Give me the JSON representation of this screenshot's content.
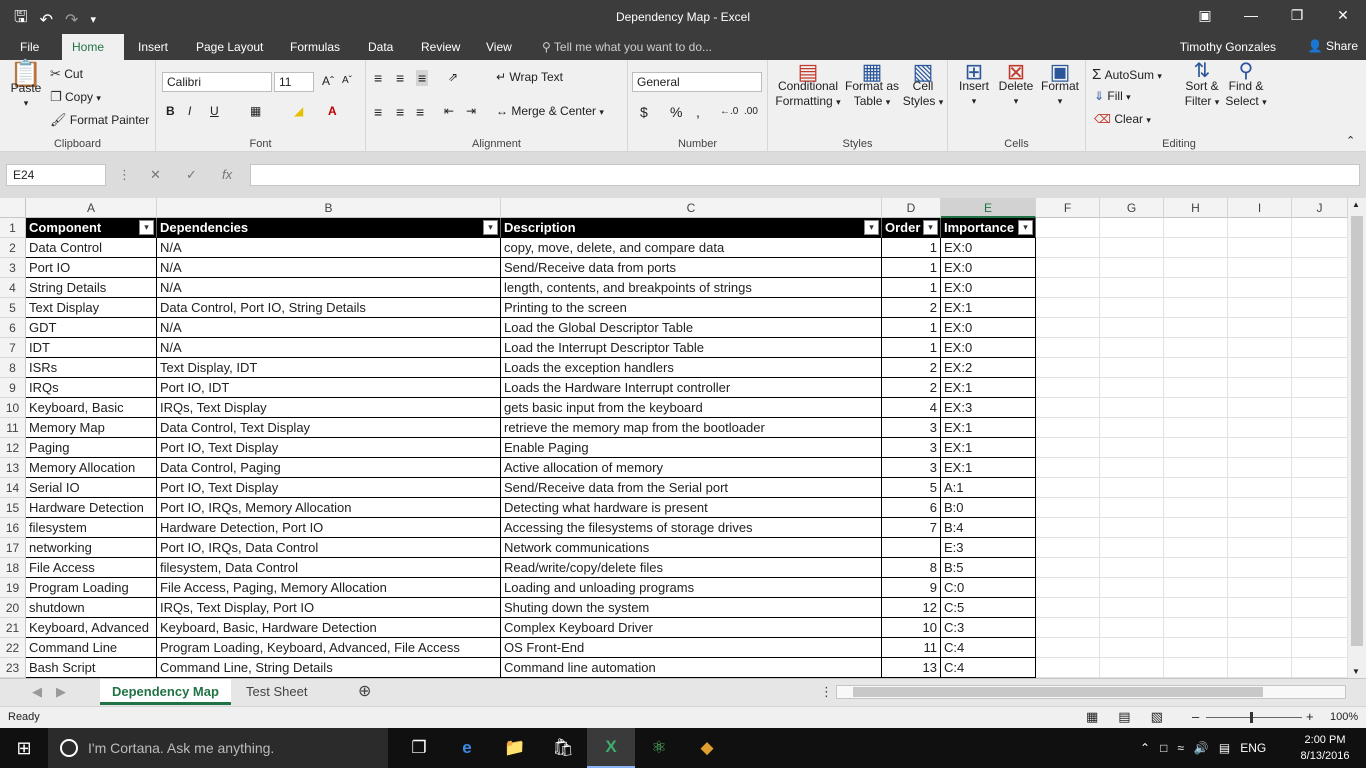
{
  "window": {
    "title": "Dependency Map - Excel",
    "qat": [
      "save-icon",
      "undo-icon",
      "redo-icon",
      "customize-icon"
    ]
  },
  "tabs": {
    "file": "File",
    "items": [
      "Home",
      "Insert",
      "Page Layout",
      "Formulas",
      "Data",
      "Review",
      "View"
    ],
    "tellme": "Tell me what you want to do...",
    "user": "Timothy Gonzales",
    "share": "Share"
  },
  "ribbon": {
    "clipboard": {
      "paste": "Paste",
      "cut": "Cut",
      "copy": "Copy",
      "format_painter": "Format Painter",
      "label": "Clipboard"
    },
    "font": {
      "name": "Calibri",
      "size": "11",
      "label": "Font",
      "bold": "B",
      "italic": "I",
      "underline": "U"
    },
    "alignment": {
      "wrap": "Wrap Text",
      "merge": "Merge & Center",
      "label": "Alignment"
    },
    "number": {
      "format": "General",
      "label": "Number",
      "currency": "$",
      "percent": "%",
      "comma": ","
    },
    "styles": {
      "conditional1": "Conditional",
      "conditional2": "Formatting",
      "format_as1": "Format as",
      "format_as2": "Table",
      "cell1": "Cell",
      "cell2": "Styles",
      "label": "Styles"
    },
    "cells": {
      "insert": "Insert",
      "delete": "Delete",
      "format": "Format",
      "label": "Cells"
    },
    "editing": {
      "autosum": "AutoSum",
      "fill": "Fill",
      "clear": "Clear",
      "sort1": "Sort &",
      "sort2": "Filter",
      "find1": "Find &",
      "find2": "Select",
      "label": "Editing"
    }
  },
  "formula_bar": {
    "name_box": "E24",
    "fx": "fx",
    "value": ""
  },
  "columns": [
    "A",
    "B",
    "C",
    "D",
    "E",
    "F",
    "G",
    "H",
    "I",
    "J"
  ],
  "headers": [
    "Component",
    "Dependencies",
    "Description",
    "Order",
    "Importance"
  ],
  "rows": [
    [
      "Data Control",
      "N/A",
      "copy, move, delete, and compare data",
      "1",
      "EX:0"
    ],
    [
      "Port IO",
      "N/A",
      "Send/Receive data from ports",
      "1",
      "EX:0"
    ],
    [
      "String Details",
      "N/A",
      "length, contents, and breakpoints of strings",
      "1",
      "EX:0"
    ],
    [
      "Text Display",
      "Data Control, Port IO, String Details",
      "Printing to the screen",
      "2",
      "EX:1"
    ],
    [
      "GDT",
      "N/A",
      "Load the Global Descriptor Table",
      "1",
      "EX:0"
    ],
    [
      "IDT",
      "N/A",
      "Load the Interrupt Descriptor Table",
      "1",
      "EX:0"
    ],
    [
      "ISRs",
      "Text Display, IDT",
      "Loads the exception handlers",
      "2",
      "EX:2"
    ],
    [
      "IRQs",
      "Port IO, IDT",
      "Loads the Hardware Interrupt controller",
      "2",
      "EX:1"
    ],
    [
      "Keyboard, Basic",
      "IRQs, Text Display",
      "gets basic input from the keyboard",
      "4",
      "EX:3"
    ],
    [
      "Memory Map",
      "Data Control, Text Display",
      "retrieve the memory map from the bootloader",
      "3",
      "EX:1"
    ],
    [
      "Paging",
      "Port IO, Text Display",
      "Enable Paging",
      "3",
      "EX:1"
    ],
    [
      "Memory Allocation",
      "Data Control, Paging",
      "Active allocation of memory",
      "3",
      "EX:1"
    ],
    [
      "Serial IO",
      "Port IO, Text Display",
      "Send/Receive data from the Serial port",
      "5",
      "A:1"
    ],
    [
      "Hardware Detection",
      "Port IO, IRQs, Memory Allocation",
      "Detecting what hardware is present",
      "6",
      "B:0"
    ],
    [
      "filesystem",
      "Hardware Detection, Port IO",
      "Accessing the filesystems of storage drives",
      "7",
      "B:4"
    ],
    [
      "networking",
      "Port IO, IRQs, Data Control",
      "Network communications",
      "",
      "E:3"
    ],
    [
      "File Access",
      "filesystem, Data Control",
      "Read/write/copy/delete files",
      "8",
      "B:5"
    ],
    [
      "Program Loading",
      "File Access, Paging, Memory Allocation",
      "Loading and unloading programs",
      "9",
      "C:0"
    ],
    [
      "shutdown",
      "IRQs, Text Display, Port IO",
      "Shuting down the system",
      "12",
      "C:5"
    ],
    [
      "Keyboard, Advanced",
      "Keyboard, Basic, Hardware Detection",
      "Complex Keyboard Driver",
      "10",
      "C:3"
    ],
    [
      "Command Line",
      "Program Loading, Keyboard, Advanced, File Access",
      "OS Front-End",
      "11",
      "C:4"
    ],
    [
      "Bash Script",
      "Command Line, String Details",
      "Command line automation",
      "13",
      "C:4"
    ]
  ],
  "sheets": {
    "active": "Dependency Map",
    "other": "Test Sheet"
  },
  "status": {
    "ready": "Ready",
    "zoom": "100%"
  },
  "taskbar": {
    "cortana": "I'm Cortana. Ask me anything.",
    "lang": "ENG",
    "time": "2:00 PM",
    "date": "8/13/2016"
  },
  "colors": {
    "excel_green": "#217346",
    "title_bg": "#3c3c3c",
    "header_row_bg": "#000000"
  }
}
